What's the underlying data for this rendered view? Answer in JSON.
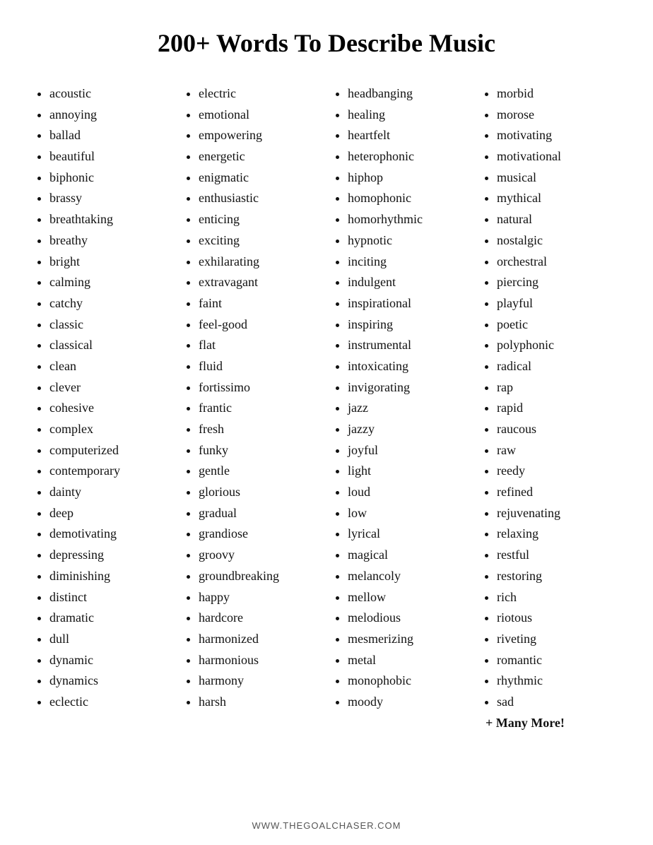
{
  "title": "200+ Words To Describe Music",
  "columns": [
    {
      "id": "col1",
      "items": [
        "acoustic",
        "annoying",
        "ballad",
        "beautiful",
        "biphonic",
        "brassy",
        "breathtaking",
        "breathy",
        "bright",
        "calming",
        "catchy",
        "classic",
        "classical",
        "clean",
        "clever",
        "cohesive",
        "complex",
        "computerized",
        "contemporary",
        "dainty",
        "deep",
        "demotivating",
        "depressing",
        "diminishing",
        "distinct",
        "dramatic",
        "dull",
        "dynamic",
        "dynamics",
        "eclectic"
      ]
    },
    {
      "id": "col2",
      "items": [
        "electric",
        "emotional",
        "empowering",
        "energetic",
        "enigmatic",
        "enthusiastic",
        "enticing",
        "exciting",
        "exhilarating",
        "extravagant",
        "faint",
        "feel-good",
        "flat",
        "fluid",
        "fortissimo",
        "frantic",
        "fresh",
        "funky",
        "gentle",
        "glorious",
        "gradual",
        "grandiose",
        "groovy",
        "groundbreaking",
        "happy",
        "hardcore",
        "harmonized",
        "harmonious",
        "harmony",
        "harsh"
      ]
    },
    {
      "id": "col3",
      "items": [
        "headbanging",
        "healing",
        "heartfelt",
        "heterophonic",
        "hiphop",
        "homophonic",
        "homorhythmic",
        "hypnotic",
        "inciting",
        "indulgent",
        "inspirational",
        "inspiring",
        "instrumental",
        "intoxicating",
        "invigorating",
        "jazz",
        "jazzy",
        "joyful",
        "light",
        "loud",
        "low",
        "lyrical",
        "magical",
        "melancoly",
        "mellow",
        "melodious",
        "mesmerizing",
        "metal",
        "monophobic",
        "moody"
      ]
    },
    {
      "id": "col4",
      "items": [
        "morbid",
        "morose",
        "motivating",
        "motivational",
        "musical",
        "mythical",
        "natural",
        "nostalgic",
        "orchestral",
        "piercing",
        "playful",
        "poetic",
        "polyphonic",
        "radical",
        "rap",
        "rapid",
        "raucous",
        "raw",
        "reedy",
        "refined",
        "rejuvenating",
        "relaxing",
        "restful",
        "restoring",
        "rich",
        "riotous",
        "riveting",
        "romantic",
        "rhythmic",
        "sad"
      ],
      "extra": "+ Many More!"
    }
  ],
  "footer": "WWW.THEGOALCHASER.COM"
}
